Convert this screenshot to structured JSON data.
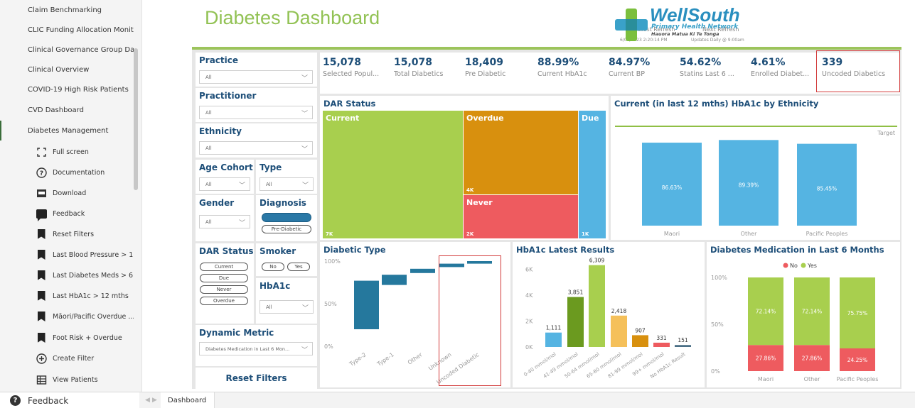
{
  "sidebar": {
    "top_items": [
      {
        "label": "Claim Benchmarking"
      },
      {
        "label": "CLIC Funding Allocation Monit..."
      },
      {
        "label": "Clinical Governance Group Das..."
      },
      {
        "label": "Clinical Overview"
      },
      {
        "label": "COVID-19 High Risk Patients"
      },
      {
        "label": "CVD Dashboard"
      },
      {
        "label": "Diabetes Management"
      }
    ],
    "sub_items": [
      {
        "label": "Full screen",
        "icon": "fullscreen-icon"
      },
      {
        "label": "Documentation",
        "icon": "help-circle-icon"
      },
      {
        "label": "Download",
        "icon": "pdf-icon"
      },
      {
        "label": "Feedback",
        "icon": "comment-icon"
      },
      {
        "label": "Reset Filters",
        "icon": "bookmark-icon"
      },
      {
        "label": "Last Blood Pressure > 1...",
        "icon": "bookmark-icon"
      },
      {
        "label": "Last Diabetes Meds > 6 ...",
        "icon": "bookmark-icon"
      },
      {
        "label": "Last HbA1c > 12 mths",
        "icon": "bookmark-icon"
      },
      {
        "label": "Māori/Pacific Overdue ...",
        "icon": "bookmark-icon"
      },
      {
        "label": "Foot Risk + Overdue",
        "icon": "bookmark-icon"
      },
      {
        "label": "Create Filter",
        "icon": "plus-circle-icon"
      },
      {
        "label": "View Patients",
        "icon": "table-icon"
      }
    ]
  },
  "footer": {
    "feedback_label": "Feedback",
    "page_tab": "Dashboard"
  },
  "header": {
    "title": "Diabetes Dashboard",
    "latest_refresh_label": "Latest Refresh",
    "latest_refresh_value": "6/07/2023 2:20:14 PM",
    "next_refresh_label": "Next Refresh",
    "next_refresh_value": "Updates Daily @ 9:00am",
    "logo_name": "WellSouth",
    "logo_sub": "Primary Health Network",
    "logo_maori": "Hauora Matua Ki Te Tonga"
  },
  "slicers": {
    "practice": {
      "title": "Practice",
      "value": "All"
    },
    "practitioner": {
      "title": "Practitioner",
      "value": "All"
    },
    "ethnicity": {
      "title": "Ethnicity",
      "value": "All"
    },
    "age_cohort": {
      "title": "Age Cohort",
      "value": "All"
    },
    "type": {
      "title": "Type",
      "value": "All"
    },
    "gender": {
      "title": "Gender",
      "value": "All"
    },
    "diagnosis": {
      "title": "Diagnosis",
      "option": "Pre-Diabetic"
    },
    "dar_status": {
      "title": "DAR Status",
      "options": [
        "Current",
        "Due",
        "Never",
        "Overdue"
      ]
    },
    "smoker": {
      "title": "Smoker",
      "options": [
        "No",
        "Yes"
      ]
    },
    "hba1c": {
      "title": "HbA1c",
      "value": "All"
    },
    "dynamic_metric": {
      "title": "Dynamic Metric",
      "value": "Diabetes Medication in Last 6 Mon..."
    },
    "reset_label": "Reset Filters"
  },
  "kpis": [
    {
      "value": "15,078",
      "label": "Selected Popul..."
    },
    {
      "value": "15,078",
      "label": "Total Diabetics"
    },
    {
      "value": "18,409",
      "label": "Pre Diabetic"
    },
    {
      "value": "88.99%",
      "label": "Current HbA1c"
    },
    {
      "value": "84.97%",
      "label": "Current BP"
    },
    {
      "value": "54.62%",
      "label": "Statins Last 6 ..."
    },
    {
      "value": "4.61%",
      "label": "Enrolled Diabet..."
    },
    {
      "value": "339",
      "label": "Uncoded Diabetics"
    }
  ],
  "dar_status": {
    "title": "DAR Status",
    "tiles": [
      {
        "label": "Current",
        "value": "7K",
        "color": "#a8cf4e"
      },
      {
        "label": "Overdue",
        "value": "4K",
        "color": "#d8900e"
      },
      {
        "label": "Never",
        "value": "2K",
        "color": "#ee5b5f"
      },
      {
        "label": "Due",
        "value": "1K",
        "color": "#55b4e2"
      }
    ]
  },
  "chart_data": [
    {
      "type": "bar",
      "title": "Current (in last 12 mths) HbA1c by Ethnicity",
      "categories": [
        "Maori",
        "Other",
        "Pacific Peoples"
      ],
      "values": [
        86.63,
        89.39,
        85.45
      ],
      "value_labels": [
        "86.63%",
        "89.39%",
        "85.45%"
      ],
      "target_label": "Target",
      "color": "#55b4e2"
    },
    {
      "type": "waterfall",
      "title": "Diabetic Type",
      "categories": [
        "Type-2",
        "Type-1",
        "Other",
        "Unknown",
        "Uncoded Diabetic"
      ],
      "start": [
        20,
        72,
        86,
        93,
        97
      ],
      "end": [
        77,
        84,
        91,
        97,
        100
      ],
      "yticks": [
        "100%",
        "50%",
        "0%"
      ],
      "color": "#25789d"
    },
    {
      "type": "bar",
      "title": "HbA1c Latest Results",
      "categories": [
        "0-40 mmol/mol",
        "41-49 mmol/mol",
        "50-64 mmol/mol",
        "65-80 mmol/mol",
        "81-99 mmol/mol",
        "99+ mmol/mol",
        "No HbA1c Result"
      ],
      "values": [
        1111,
        3851,
        6309,
        2418,
        907,
        331,
        151
      ],
      "value_labels": [
        "1,111",
        "3,851",
        "6,309",
        "2,418",
        "907",
        "331",
        "151"
      ],
      "colors": [
        "#55b4e2",
        "#6b9a1f",
        "#a8cf4e",
        "#f5c05a",
        "#d8900e",
        "#ee5b5f",
        "#4a6f86"
      ],
      "yticks": [
        "6K",
        "4K",
        "2K",
        "0K"
      ],
      "ylim": [
        0,
        7000
      ]
    },
    {
      "type": "stacked-bar",
      "title": "Diabetes Medication in Last 6 Months",
      "categories": [
        "Maori",
        "Other",
        "Pacific Peoples"
      ],
      "series": [
        {
          "name": "No",
          "values": [
            27.86,
            27.86,
            24.25
          ],
          "labels": [
            "27.86%",
            "27.86%",
            "24.25%"
          ],
          "color": "#ee5b5f"
        },
        {
          "name": "Yes",
          "values": [
            72.14,
            72.14,
            75.75
          ],
          "labels": [
            "72.14%",
            "72.14%",
            "75.75%"
          ],
          "color": "#a8cf4e"
        }
      ],
      "yticks": [
        "100%",
        "50%",
        "0%"
      ],
      "legend": "top"
    }
  ]
}
